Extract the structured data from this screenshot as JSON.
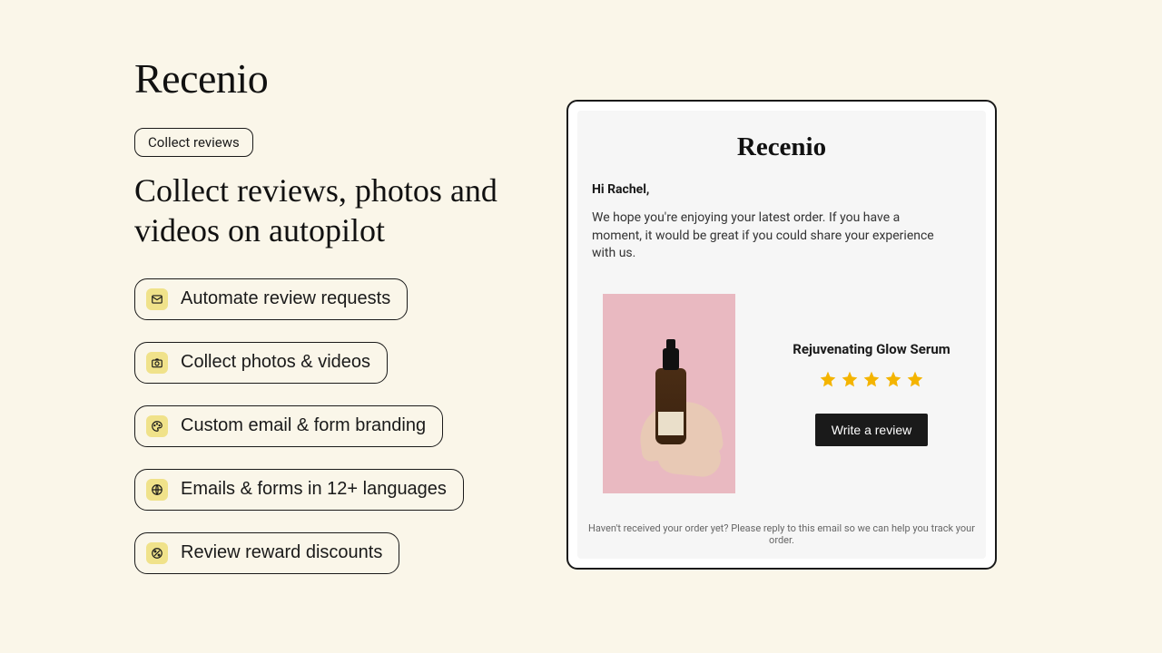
{
  "left": {
    "brand": "Recenio",
    "badge": "Collect reviews",
    "headline": "Collect reviews, photos and videos on autopilot",
    "features": [
      {
        "icon": "mail",
        "label": "Automate review requests"
      },
      {
        "icon": "camera",
        "label": "Collect photos & videos"
      },
      {
        "icon": "palette",
        "label": "Custom email & form branding"
      },
      {
        "icon": "globe",
        "label": "Emails & forms in 12+ languages"
      },
      {
        "icon": "percent",
        "label": "Review reward discounts"
      }
    ]
  },
  "email": {
    "brand": "Recenio",
    "greeting": "Hi Rachel,",
    "body": "We hope you're enjoying your latest order. If you have a moment, it would be great if you could share your experience with us.",
    "product_name": "Rejuvenating Glow Serum",
    "rating": 5,
    "cta": "Write a review",
    "footer": "Haven't received your order yet? Please reply to this email so we can help you track your order."
  }
}
